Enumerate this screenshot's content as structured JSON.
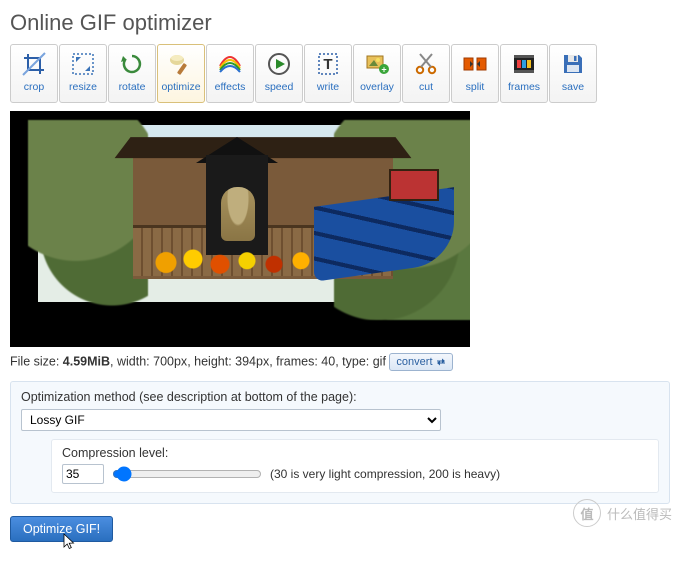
{
  "title": "Online GIF optimizer",
  "toolbar": [
    {
      "id": "crop",
      "label": "crop",
      "active": false
    },
    {
      "id": "resize",
      "label": "resize",
      "active": false
    },
    {
      "id": "rotate",
      "label": "rotate",
      "active": false
    },
    {
      "id": "optimize",
      "label": "optimize",
      "active": true
    },
    {
      "id": "effects",
      "label": "effects",
      "active": false
    },
    {
      "id": "speed",
      "label": "speed",
      "active": false
    },
    {
      "id": "write",
      "label": "write",
      "active": false
    },
    {
      "id": "overlay",
      "label": "overlay",
      "active": false
    },
    {
      "id": "cut",
      "label": "cut",
      "active": false
    },
    {
      "id": "split",
      "label": "split",
      "active": false
    },
    {
      "id": "frames",
      "label": "frames",
      "active": false
    },
    {
      "id": "save",
      "label": "save",
      "active": false
    }
  ],
  "fileinfo": {
    "size_label": "File size: ",
    "size_value": "4.59MiB",
    "width_label": ", width: 700px",
    "height_label": ", height: 394px",
    "frames_label": ", frames: 40",
    "type_label": ", type: gif",
    "convert_label": "convert"
  },
  "panel": {
    "method_label": "Optimization method (see description at bottom of the page):",
    "method_value": "Lossy GIF",
    "compression_label": "Compression level:",
    "compression_value": "35",
    "compression_min": "30",
    "compression_max": "200",
    "compression_hint": "(30 is very light compression, 200 is heavy)"
  },
  "buttons": {
    "optimize": "Optimize GIF!"
  },
  "watermark": {
    "badge": "值",
    "text": "什么值得买"
  }
}
